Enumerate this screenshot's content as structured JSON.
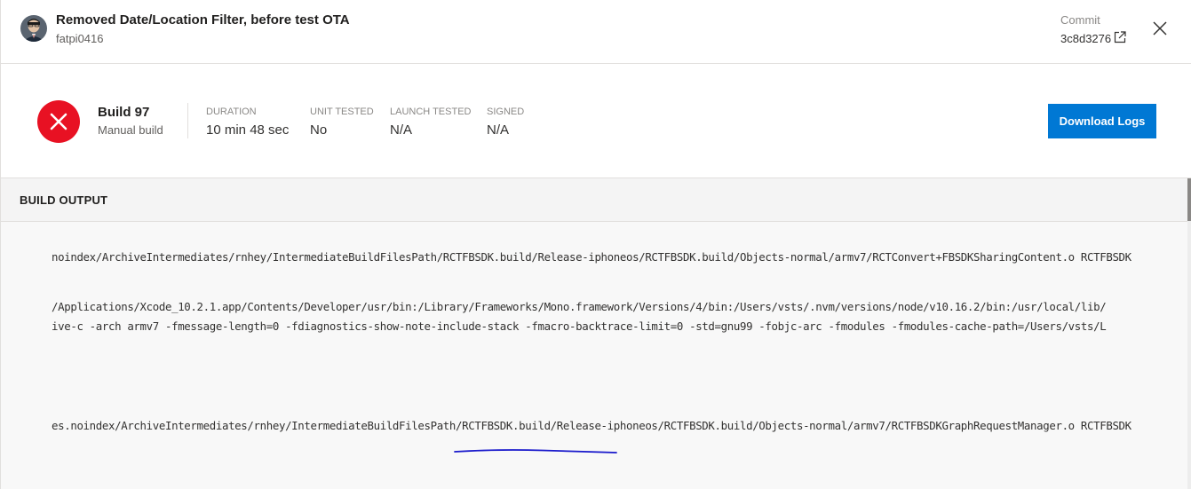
{
  "header": {
    "commit_message": "Removed Date/Location Filter, before test OTA",
    "author": "fatpi0416",
    "commit_label": "Commit",
    "commit_hash": "3c8d3276"
  },
  "build": {
    "name": "Build 97",
    "type": "Manual build",
    "status_color": "#e81123",
    "stats": [
      {
        "label": "DURATION",
        "value": "10 min 48 sec"
      },
      {
        "label": "UNIT TESTED",
        "value": "No"
      },
      {
        "label": "LAUNCH TESTED",
        "value": "N/A"
      },
      {
        "label": "SIGNED",
        "value": "N/A"
      }
    ],
    "download_label": "Download Logs"
  },
  "output": {
    "title": "BUILD OUTPUT",
    "lines": [
      "noindex/ArchiveIntermediates/rnhey/IntermediateBuildFilesPath/RCTFBSDK.build/Release-iphoneos/RCTFBSDK.build/Objects-normal/armv7/RCTConvert+FBSDKSharingContent.o RCTFBSDK",
      "/Applications/Xcode_10.2.1.app/Contents/Developer/usr/bin:/Library/Frameworks/Mono.framework/Versions/4/bin:/Users/vsts/.nvm/versions/node/v10.16.2/bin:/usr/local/lib/",
      "ive-c -arch armv7 -fmessage-length=0 -fdiagnostics-show-note-include-stack -fmacro-backtrace-limit=0 -std=gnu99 -fobjc-arc -fmodules -fmodules-cache-path=/Users/vsts/L",
      "es.noindex/ArchiveIntermediates/rnhey/IntermediateBuildFilesPath/RCTFBSDK.build/Release-iphoneos/RCTFBSDK.build/Objects-normal/armv7/RCTFBSDKGraphRequestManager.o RCTFBSDK"
    ]
  },
  "colors": {
    "accent": "#0078d4",
    "fail": "#e81123",
    "annotation": "#1a1acc"
  },
  "icons": {
    "avatar": "avatar",
    "fail": "close-circle-icon",
    "external": "external-link-icon",
    "close": "close-icon"
  }
}
